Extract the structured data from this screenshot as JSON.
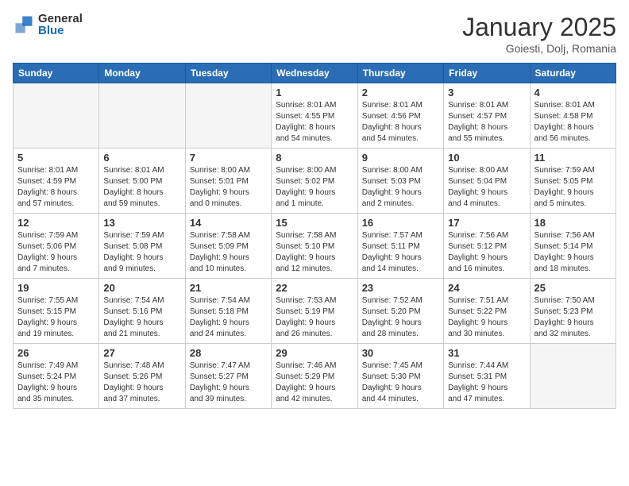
{
  "header": {
    "logo_general": "General",
    "logo_blue": "Blue",
    "title": "January 2025",
    "subtitle": "Goiesti, Dolj, Romania"
  },
  "weekdays": [
    "Sunday",
    "Monday",
    "Tuesday",
    "Wednesday",
    "Thursday",
    "Friday",
    "Saturday"
  ],
  "weeks": [
    [
      {
        "day": "",
        "info": ""
      },
      {
        "day": "",
        "info": ""
      },
      {
        "day": "",
        "info": ""
      },
      {
        "day": "1",
        "info": "Sunrise: 8:01 AM\nSunset: 4:55 PM\nDaylight: 8 hours\nand 54 minutes."
      },
      {
        "day": "2",
        "info": "Sunrise: 8:01 AM\nSunset: 4:56 PM\nDaylight: 8 hours\nand 54 minutes."
      },
      {
        "day": "3",
        "info": "Sunrise: 8:01 AM\nSunset: 4:57 PM\nDaylight: 8 hours\nand 55 minutes."
      },
      {
        "day": "4",
        "info": "Sunrise: 8:01 AM\nSunset: 4:58 PM\nDaylight: 8 hours\nand 56 minutes."
      }
    ],
    [
      {
        "day": "5",
        "info": "Sunrise: 8:01 AM\nSunset: 4:59 PM\nDaylight: 8 hours\nand 57 minutes."
      },
      {
        "day": "6",
        "info": "Sunrise: 8:01 AM\nSunset: 5:00 PM\nDaylight: 8 hours\nand 59 minutes."
      },
      {
        "day": "7",
        "info": "Sunrise: 8:00 AM\nSunset: 5:01 PM\nDaylight: 9 hours\nand 0 minutes."
      },
      {
        "day": "8",
        "info": "Sunrise: 8:00 AM\nSunset: 5:02 PM\nDaylight: 9 hours\nand 1 minute."
      },
      {
        "day": "9",
        "info": "Sunrise: 8:00 AM\nSunset: 5:03 PM\nDaylight: 9 hours\nand 2 minutes."
      },
      {
        "day": "10",
        "info": "Sunrise: 8:00 AM\nSunset: 5:04 PM\nDaylight: 9 hours\nand 4 minutes."
      },
      {
        "day": "11",
        "info": "Sunrise: 7:59 AM\nSunset: 5:05 PM\nDaylight: 9 hours\nand 5 minutes."
      }
    ],
    [
      {
        "day": "12",
        "info": "Sunrise: 7:59 AM\nSunset: 5:06 PM\nDaylight: 9 hours\nand 7 minutes."
      },
      {
        "day": "13",
        "info": "Sunrise: 7:59 AM\nSunset: 5:08 PM\nDaylight: 9 hours\nand 9 minutes."
      },
      {
        "day": "14",
        "info": "Sunrise: 7:58 AM\nSunset: 5:09 PM\nDaylight: 9 hours\nand 10 minutes."
      },
      {
        "day": "15",
        "info": "Sunrise: 7:58 AM\nSunset: 5:10 PM\nDaylight: 9 hours\nand 12 minutes."
      },
      {
        "day": "16",
        "info": "Sunrise: 7:57 AM\nSunset: 5:11 PM\nDaylight: 9 hours\nand 14 minutes."
      },
      {
        "day": "17",
        "info": "Sunrise: 7:56 AM\nSunset: 5:12 PM\nDaylight: 9 hours\nand 16 minutes."
      },
      {
        "day": "18",
        "info": "Sunrise: 7:56 AM\nSunset: 5:14 PM\nDaylight: 9 hours\nand 18 minutes."
      }
    ],
    [
      {
        "day": "19",
        "info": "Sunrise: 7:55 AM\nSunset: 5:15 PM\nDaylight: 9 hours\nand 19 minutes."
      },
      {
        "day": "20",
        "info": "Sunrise: 7:54 AM\nSunset: 5:16 PM\nDaylight: 9 hours\nand 21 minutes."
      },
      {
        "day": "21",
        "info": "Sunrise: 7:54 AM\nSunset: 5:18 PM\nDaylight: 9 hours\nand 24 minutes."
      },
      {
        "day": "22",
        "info": "Sunrise: 7:53 AM\nSunset: 5:19 PM\nDaylight: 9 hours\nand 26 minutes."
      },
      {
        "day": "23",
        "info": "Sunrise: 7:52 AM\nSunset: 5:20 PM\nDaylight: 9 hours\nand 28 minutes."
      },
      {
        "day": "24",
        "info": "Sunrise: 7:51 AM\nSunset: 5:22 PM\nDaylight: 9 hours\nand 30 minutes."
      },
      {
        "day": "25",
        "info": "Sunrise: 7:50 AM\nSunset: 5:23 PM\nDaylight: 9 hours\nand 32 minutes."
      }
    ],
    [
      {
        "day": "26",
        "info": "Sunrise: 7:49 AM\nSunset: 5:24 PM\nDaylight: 9 hours\nand 35 minutes."
      },
      {
        "day": "27",
        "info": "Sunrise: 7:48 AM\nSunset: 5:26 PM\nDaylight: 9 hours\nand 37 minutes."
      },
      {
        "day": "28",
        "info": "Sunrise: 7:47 AM\nSunset: 5:27 PM\nDaylight: 9 hours\nand 39 minutes."
      },
      {
        "day": "29",
        "info": "Sunrise: 7:46 AM\nSunset: 5:29 PM\nDaylight: 9 hours\nand 42 minutes."
      },
      {
        "day": "30",
        "info": "Sunrise: 7:45 AM\nSunset: 5:30 PM\nDaylight: 9 hours\nand 44 minutes."
      },
      {
        "day": "31",
        "info": "Sunrise: 7:44 AM\nSunset: 5:31 PM\nDaylight: 9 hours\nand 47 minutes."
      },
      {
        "day": "",
        "info": ""
      }
    ]
  ]
}
